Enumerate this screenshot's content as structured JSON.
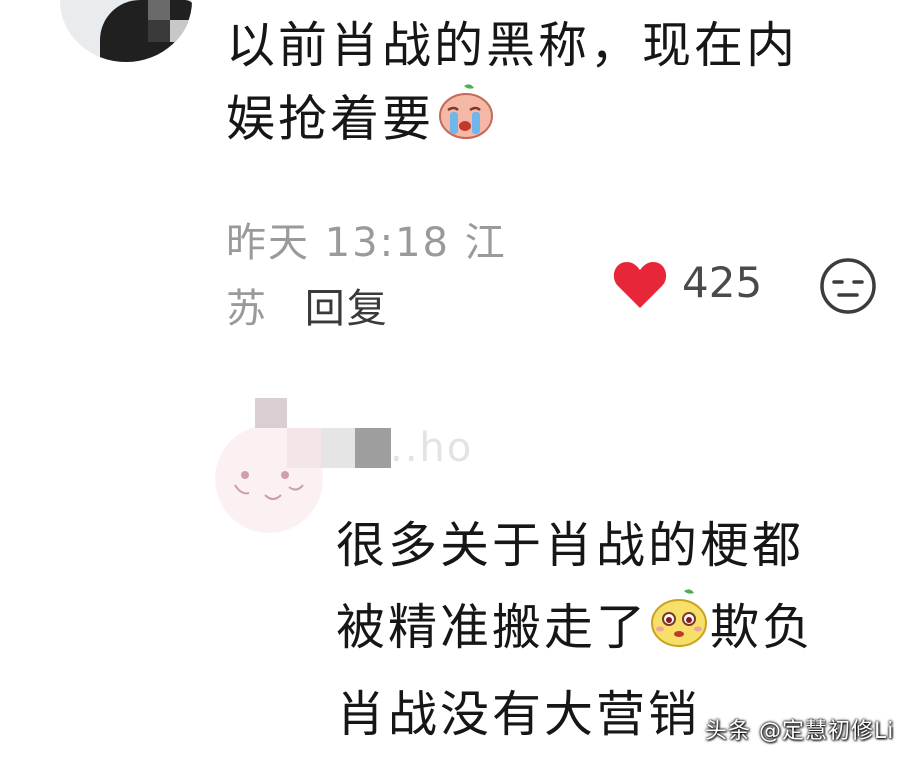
{
  "comments": [
    {
      "text_line1": "以前肖战的黑称，现在内",
      "text_line2": "娱抢着要",
      "emoji": "crying-peach-emoji",
      "meta_line1": "昨天 13:18 江",
      "meta_line2": "苏",
      "reply_label": "回复",
      "likes": "425"
    },
    {
      "username_fragment": "..ho",
      "text_line1": "很多关于肖战的梗都",
      "text_line2": "被精准搬走了",
      "emoji": "smug-peach-emoji",
      "text_line2_tail": "欺负",
      "text_line3": "肖战没有大营销"
    }
  ],
  "watermark": "头条 @定慧初修Li",
  "colors": {
    "like_heart": "#e7263a",
    "meta_gray": "#9a9a9a",
    "text": "#161616"
  }
}
